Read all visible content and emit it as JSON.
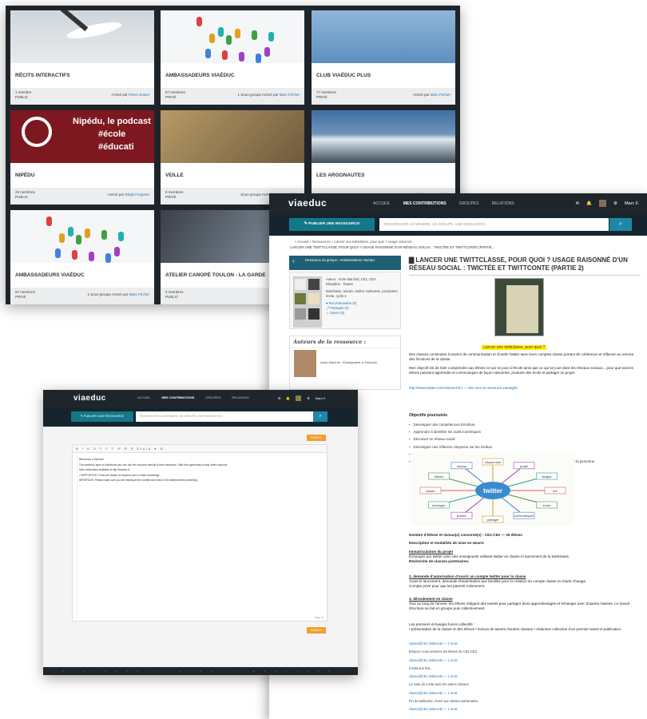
{
  "groups": {
    "cards": [
      {
        "title": "RÉCITS INTERACTIFS",
        "members": "1 membre",
        "visibility": "PUBLIC",
        "sub": "",
        "animator_prefix": "Animé par",
        "animator": "Pierre Soulet",
        "img": "stork"
      },
      {
        "title": "AMBASSADEURS VIAÉDUC",
        "members": "97 membres",
        "visibility": "PRIVÉ",
        "sub": "1 Sous-groupe",
        "animator_prefix": "Animé par",
        "animator": "Marc Fécher",
        "img": "network"
      },
      {
        "title": "CLUB VIAÉDUC PLUS",
        "members": "77 membres",
        "visibility": "PRIVÉ",
        "sub": "",
        "animator_prefix": "Animé par",
        "animator": "Marc Fécher",
        "img": "hands"
      },
      {
        "title": "NIPÉDU",
        "members": "23 membres",
        "visibility": "PUBLIC",
        "sub": "",
        "animator_prefix": "Animé par",
        "animator": "Régis Forgione",
        "img": "podcast"
      },
      {
        "title": "VEILLE",
        "members": "8 membres",
        "visibility": "PRIVÉ",
        "sub": "Sous-groupe",
        "animator_prefix": "Animé par",
        "animator": "Marc Fécher",
        "img": "compass"
      },
      {
        "title": "LES ARGONAUTES",
        "members": "",
        "visibility": "",
        "sub": "",
        "animator_prefix": "Animé par",
        "animator": "Marc Fécher",
        "img": "mountains"
      },
      {
        "title": "AMBASSADEURS VIAÉDUC",
        "members": "97 membres",
        "visibility": "PRIVÉ",
        "sub": "1 Sous-groupe",
        "animator_prefix": "Animé par",
        "animator": "Marc Fécher",
        "img": "network"
      },
      {
        "title": "ATELIER CANOPÉ TOULON - LA GARDE",
        "members": "6 membres",
        "visibility": "PUBLIC",
        "sub": "",
        "animator_prefix": "",
        "animator": "",
        "img": "tablet"
      }
    ],
    "podcast_line1": "Nipédu, le podcast",
    "podcast_line2": "#école",
    "podcast_line3": "#éducati"
  },
  "resource_page": {
    "logo": "viaeduc",
    "nav": [
      "ACCUEIL",
      "MES CONTRIBUTIONS",
      "GROUPES",
      "RELATIONS"
    ],
    "user": "Marc F.",
    "publish_button": "PUBLIER UNE RESSOURCE",
    "search_placeholder": "RECHERCHER UN MEMBRE, UN GROUPE, UNE RESSOURCE...",
    "breadcrumb": "» Accueil » Ressources » Lancer une twittclasse, pour quoi ? usage raisonné...",
    "breadcrumb2": "LANCER UNE TWITTCLASSE, POUR QUOI ? USAGE RAISONNÉ D'UN RÉSEAU SOCIAL : TWICTÉE ET TWITTCONTE (PARTIE...",
    "side_banner": "Ressource du groupe : Ambassadeurs Viaéduc",
    "side_meta": "Auteur : Anne Marchal, CE1, CE2",
    "side_discipline": "Discipline : Toutes",
    "side_tags": "twittclasse, twictée, twitter, twittconte, production écrite, cycle 2",
    "side_links": [
      "♥ Recommandée (0)",
      "⤴ Partagée (0)",
      "☆ Suivre (0)"
    ],
    "authors_heading": "Auteurs de la ressource :",
    "author_name": "Anne Marchal · Enseignante à Toulouse",
    "title": "LANCER UNE TWITTCLASSE, POUR QUOI ? USAGE RAISONNÉ D'UN RÉSEAU SOCIAL : TWICTÉE ET TWITTCONTE (PARTIE 2)",
    "highlight": "Lancer une twittclasse, pour quoi ?",
    "intro1": "Des classes construites à travers de communication et d'outils Twitter avec leurs comptes-classe portant de cohérence et réflexion au service des fonctions de la classe.",
    "intro2": "Mon objectif est de faire comprendre aux élèves ce qui se joue à l'école ainsi que ce qui se joue dans les réseaux sociaux... pour que tout les élèves puissent apprendre et communiquer de façon raisonnée, produire des écrits et partager un projet.",
    "url": "http://www.twitter.com/classe/CE1 — lien vers la ressource partagée",
    "objectives_title": "Objectifs poursuivis",
    "objectives": [
      "Développer des compétences d'écriture",
      "Apprendre à identifier les outils numériques",
      "Découvrir un réseau social",
      "Développer une réflexion citoyenne sur les médias",
      "Communiquer avec d'autres classes et partenaires",
      "Sensibilisation aux usages d'Internet et aux risques des réseaux sociaux, identité numérique et droits de la personne"
    ],
    "mindmap_center": "twitter",
    "mindmap_nodes": [
      "lire",
      "écrire",
      "communiquer",
      "partager",
      "publier",
      "échanger",
      "classe",
      "élèves",
      "réseau",
      "citoyenneté",
      "projet",
      "langue"
    ],
    "levels": "Nombre d'élèves et niveau(x) concerné(s) : CE1-CE2 — 25 élèves",
    "desc_title": "Description et modalités de mise en œuvre",
    "s1_title": "Immatriculation du projet",
    "s1_text": "Échanges par twitter avec des enseignants utilisant twitter en classe et lancement de la twittclasse.",
    "s1_text2": "Recherche de classes partenaires.",
    "s2_title": "2. demande d'autorisation d'ouvrir un compte twitter pour la classe",
    "s2_text": "Avant le lancement, demande d'autorisation aux familles pour la création du compte classe et charte d'usage.",
    "s2_text2": "Compte privé pour que les parents s'abonnent.",
    "s3_title": "3. déroulement en classe",
    "s3_text": "Tout au long de l'année, les élèves rédigent des tweets pour partager leurs apprentissages et échanger avec d'autres classes. Le travail d'écriture se fait en groupe puis collectivement.",
    "s4_text": "Les premiers échanges furent collectifs :",
    "s4_list": "• présentation de la classe et des élèves • lecture de tweets d'autres classes • rédaction collective d'un premier tweet et publication",
    "tweets": [
      "classe@CE1 twittconte — 1 mois",
      "Bonjour, nous sommes les élèves de CE1-CE2",
      "classe@CE1 twittconte — 1 mois",
      "Il était une fois...",
      "classe@CE1 twittconte — 1 mois",
      "La suite du conte avec les autres classes",
      "classe@CE1 twittconte — 1 mois",
      "Fin du twittconte, merci aux classes partenaires",
      "classe@CE1 twittconte — 1 mois"
    ]
  },
  "editor_page": {
    "logo": "viaeduc",
    "nav": [
      "ACCUEIL",
      "MES CONTRIBUTIONS",
      "GROUPES",
      "RELATIONS"
    ],
    "user": "Marc F.",
    "publish_button": "PUBLIER UNE RESSOURCE",
    "search_placeholder": "RECHERCHER UN MEMBRE, UN GROUPE, UNE RESSOURCE...",
    "top_button": "PUBLIER",
    "bottom_button": "PUBLIER",
    "toolbar": "B I U S ≡ ≡ ≡ ⟲ ⟳ ¶ Style ▾ ⊘",
    "lines": [
      "Bienvenue à Viaéduc!",
      "The summit is open to individuals who can use this resource directly in their classroom. Take this opportunity to help others improve.",
      "More information available at http://viaeduc.fr",
      "• SUPPORTIVE: Posts are helpful for teachers and to share knowledge.",
      "IMPORTANT: Please make sure you are reading all the content and video in its entirety before publishing."
    ],
    "link_text": "http://viaeduc.fr",
    "wordcount": "Mots : 0",
    "footer": "À propos · Aide · Mentions légales · Contact"
  }
}
